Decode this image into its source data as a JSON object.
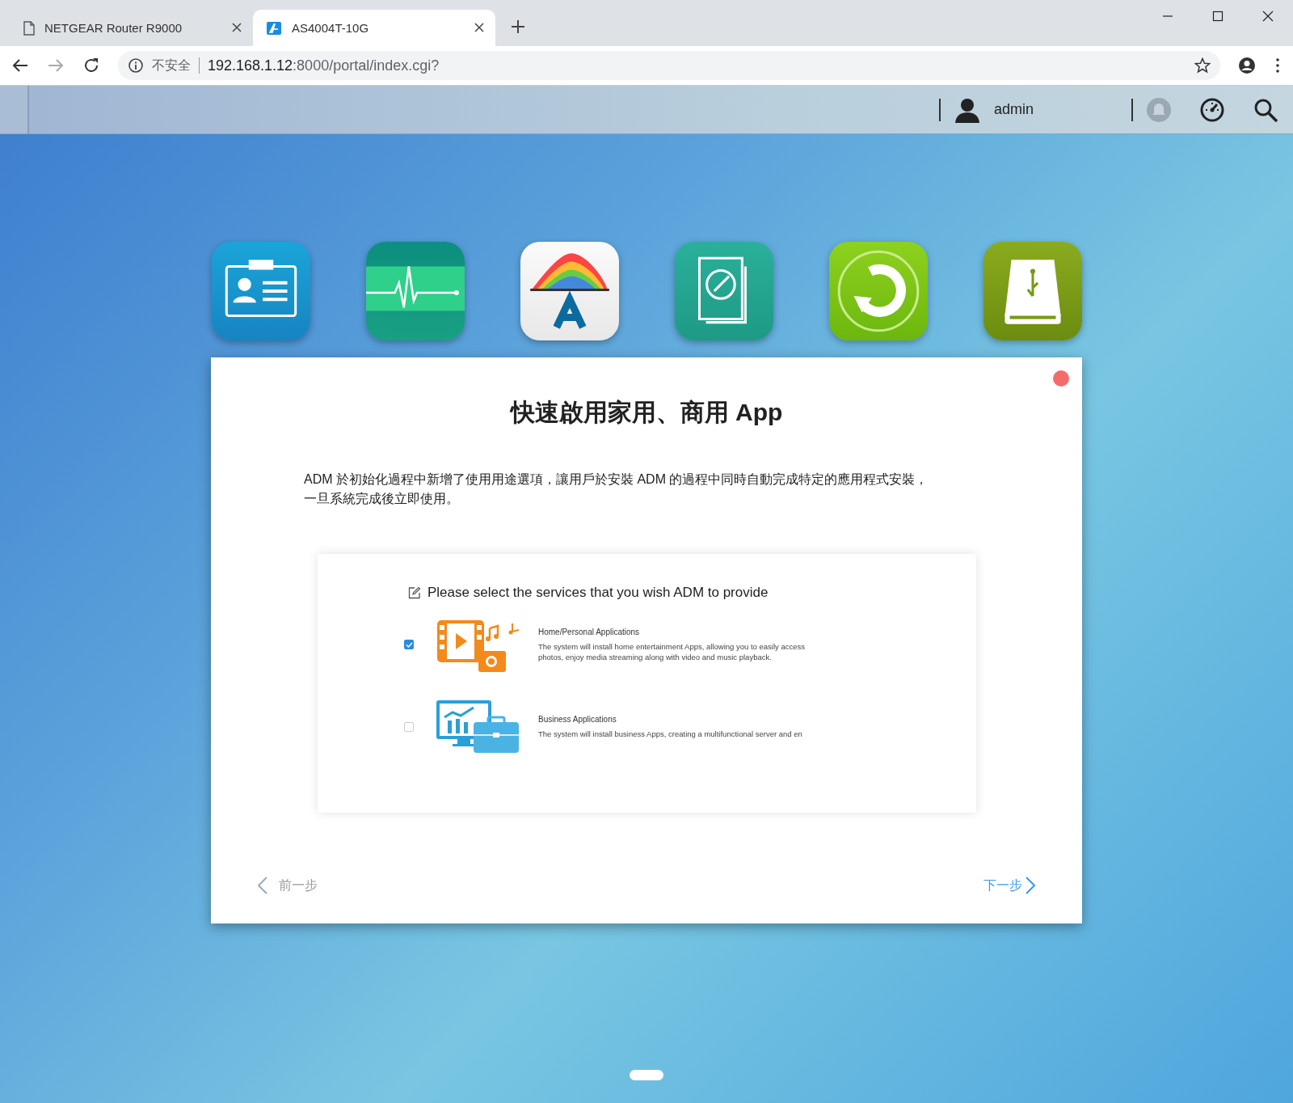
{
  "browser": {
    "tabs": [
      {
        "title": "NETGEAR Router R9000",
        "selected": false,
        "kind": "page"
      },
      {
        "title": "AS4004T-10G",
        "selected": true,
        "kind": "app"
      }
    ],
    "security_label": "不安全",
    "url_host": "192.168.1.12",
    "url_rest": ":8000/portal/index.cgi?"
  },
  "app_bar": {
    "user": "admin"
  },
  "apps": [
    {
      "kind": "contacts"
    },
    {
      "kind": "monitor"
    },
    {
      "kind": "store"
    },
    {
      "kind": "compass"
    },
    {
      "kind": "sync"
    },
    {
      "kind": "usb"
    }
  ],
  "dialog": {
    "title": "快速啟用家用、商用 App",
    "description_lines": [
      "ADM 於初始化過程中新增了使用用途選項，讓用戶於安裝 ADM 的過程中同時自動完成特定的應用程式安裝，",
      "一旦系統完成後立即使用。"
    ],
    "card": {
      "heading": "Please select the services that you wish ADM to provide",
      "options": [
        {
          "kind": "home",
          "title": "Home/Personal Applications",
          "description": "The system will install home entertainment Apps, allowing you to easily access photos, enjoy media streaming along with video and music playback.",
          "checked": true
        },
        {
          "kind": "business",
          "title": "Business Applications",
          "description": "The system will install business Apps, creating a multifunctional server and en",
          "checked": false
        }
      ]
    },
    "back_label": "前一步",
    "next_label": "下一步"
  }
}
